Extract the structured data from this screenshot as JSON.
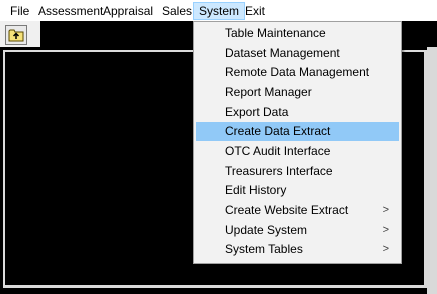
{
  "menubar": {
    "items": [
      {
        "label": "File"
      },
      {
        "label": "Assessment"
      },
      {
        "label": "Appraisal"
      },
      {
        "label": "Sales"
      },
      {
        "label": "System"
      },
      {
        "label": "Exit"
      }
    ]
  },
  "toolbar": {
    "button_icon": "folder-up-icon"
  },
  "system_menu": {
    "items": [
      {
        "label": "Table Maintenance"
      },
      {
        "label": "Dataset Management"
      },
      {
        "label": "Remote Data Management"
      },
      {
        "label": "Report Manager"
      },
      {
        "label": "Export Data"
      },
      {
        "label": "Create Data Extract"
      },
      {
        "label": "OTC Audit Interface"
      },
      {
        "label": "Treasurers Interface"
      },
      {
        "label": "Edit History"
      },
      {
        "label": "Create Website Extract",
        "submenu_arrow": ">"
      },
      {
        "label": "Update System",
        "submenu_arrow": ">"
      },
      {
        "label": "System Tables",
        "submenu_arrow": ">"
      }
    ],
    "highlighted_item": "Create Data Extract"
  },
  "colors": {
    "workspace_background": "#000000",
    "menu_background": "#f2f2f2",
    "highlight": "#91c9f7",
    "active_menubar_item": "#cce8ff"
  }
}
